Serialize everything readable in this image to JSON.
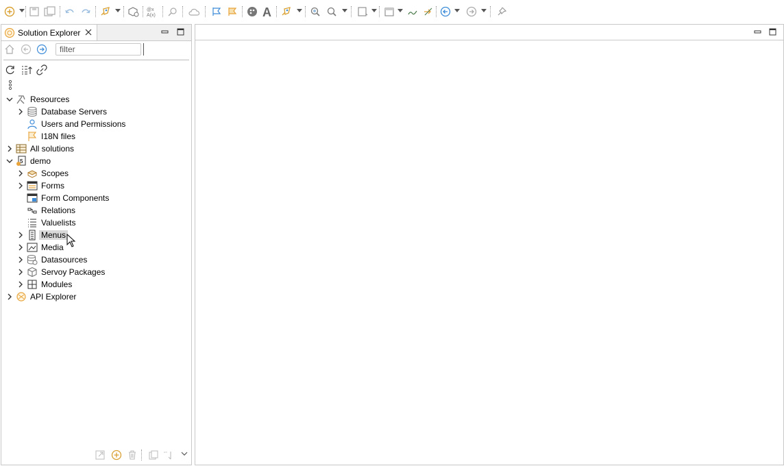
{
  "explorer": {
    "tab_title": "Solution Explorer",
    "filter_placeholder": "filter"
  },
  "tree": [
    {
      "label": "Resources",
      "icon": "resources-icon",
      "expanded": true
    },
    {
      "label": "Database Servers",
      "icon": "database-icon"
    },
    {
      "label": "Users and Permissions",
      "icon": "user-icon"
    },
    {
      "label": "I18N files",
      "icon": "flag-icon"
    },
    {
      "label": "All solutions",
      "icon": "solutions-icon"
    },
    {
      "label": "demo",
      "icon": "solution-demo-icon",
      "expanded": true
    },
    {
      "label": "Scopes",
      "icon": "scopes-icon"
    },
    {
      "label": "Forms",
      "icon": "forms-icon"
    },
    {
      "label": "Form Components",
      "icon": "form-components-icon"
    },
    {
      "label": "Relations",
      "icon": "relations-icon"
    },
    {
      "label": "Valuelists",
      "icon": "valuelists-icon"
    },
    {
      "label": "Menus",
      "icon": "menus-icon",
      "selected": true
    },
    {
      "label": "Media",
      "icon": "media-icon"
    },
    {
      "label": "Datasources",
      "icon": "datasources-icon"
    },
    {
      "label": "Servoy Packages",
      "icon": "package-icon"
    },
    {
      "label": "Modules",
      "icon": "modules-icon"
    },
    {
      "label": "API Explorer",
      "icon": "api-explorer-icon"
    }
  ],
  "colors": {
    "accent_blue": "#3c8bd9",
    "accent_orange": "#e8a33a",
    "selection": "#d9d9d9"
  }
}
